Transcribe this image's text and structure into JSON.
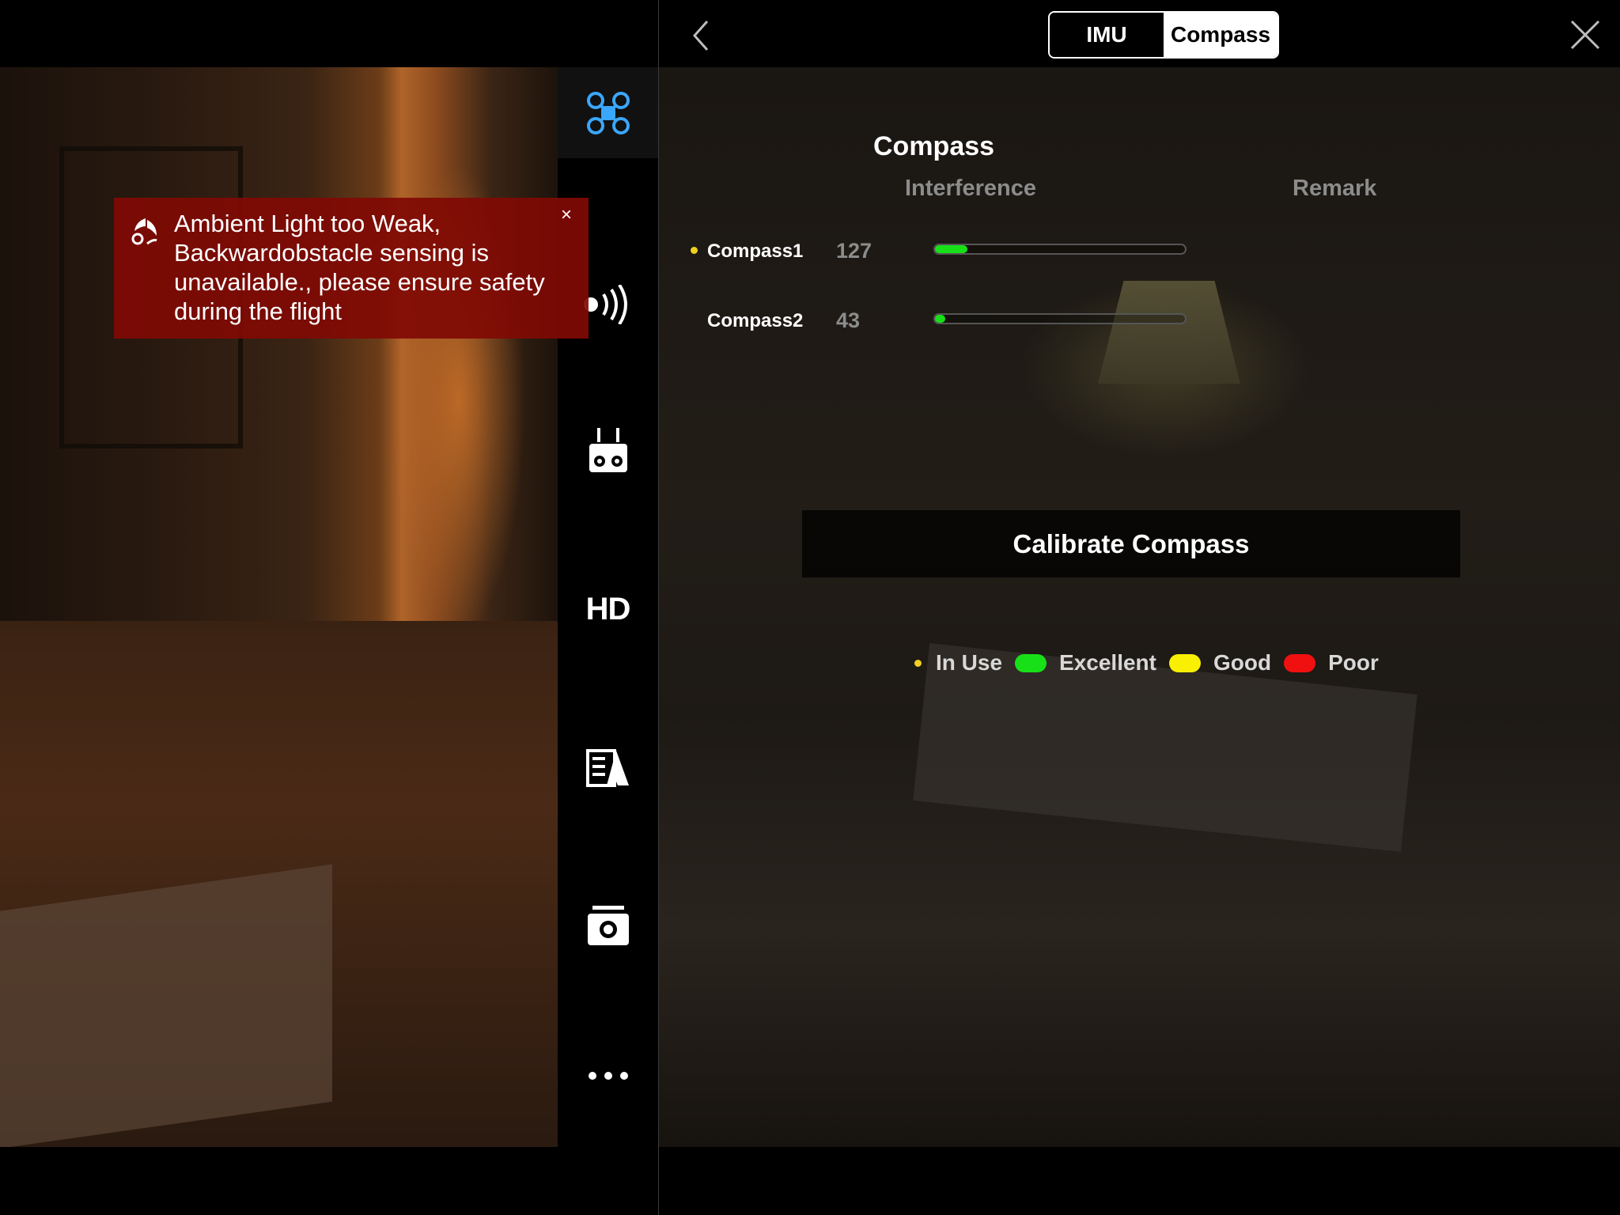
{
  "tabs": {
    "imu": "IMU",
    "compass": "Compass",
    "active": "compass"
  },
  "section": {
    "title": "Compass"
  },
  "columns": {
    "interference": "Interference",
    "remark": "Remark"
  },
  "compasses": [
    {
      "name": "Compass1",
      "value": "127",
      "in_use": true,
      "level": 0.13,
      "color": "#18e018"
    },
    {
      "name": "Compass2",
      "value": "43",
      "in_use": false,
      "level": 0.04,
      "color": "#18e018"
    }
  ],
  "calibrate_label": "Calibrate Compass",
  "legend": {
    "in_use": "In Use",
    "excellent": "Excellent",
    "good": "Good",
    "poor": "Poor",
    "colors": {
      "in_use": "#f0d020",
      "excellent": "#18e018",
      "good": "#f8f000",
      "poor": "#f01010"
    }
  },
  "alert": {
    "message": "Ambient Light too Weak, Backwardobstacle sensing is unavailable., please ensure safety during the flight",
    "close_glyph": "×",
    "icon": "obstacle-sensing-icon"
  },
  "side_nav": [
    {
      "icon": "aircraft-icon",
      "active": true,
      "accent": "#3aa7ff"
    },
    {
      "icon": "sensor-signal-icon"
    },
    {
      "icon": "remote-controller-icon"
    },
    {
      "icon": "hd-transmission-icon",
      "label": "HD"
    },
    {
      "icon": "battery-icon"
    },
    {
      "icon": "camera-icon"
    },
    {
      "icon": "more-icon"
    }
  ]
}
